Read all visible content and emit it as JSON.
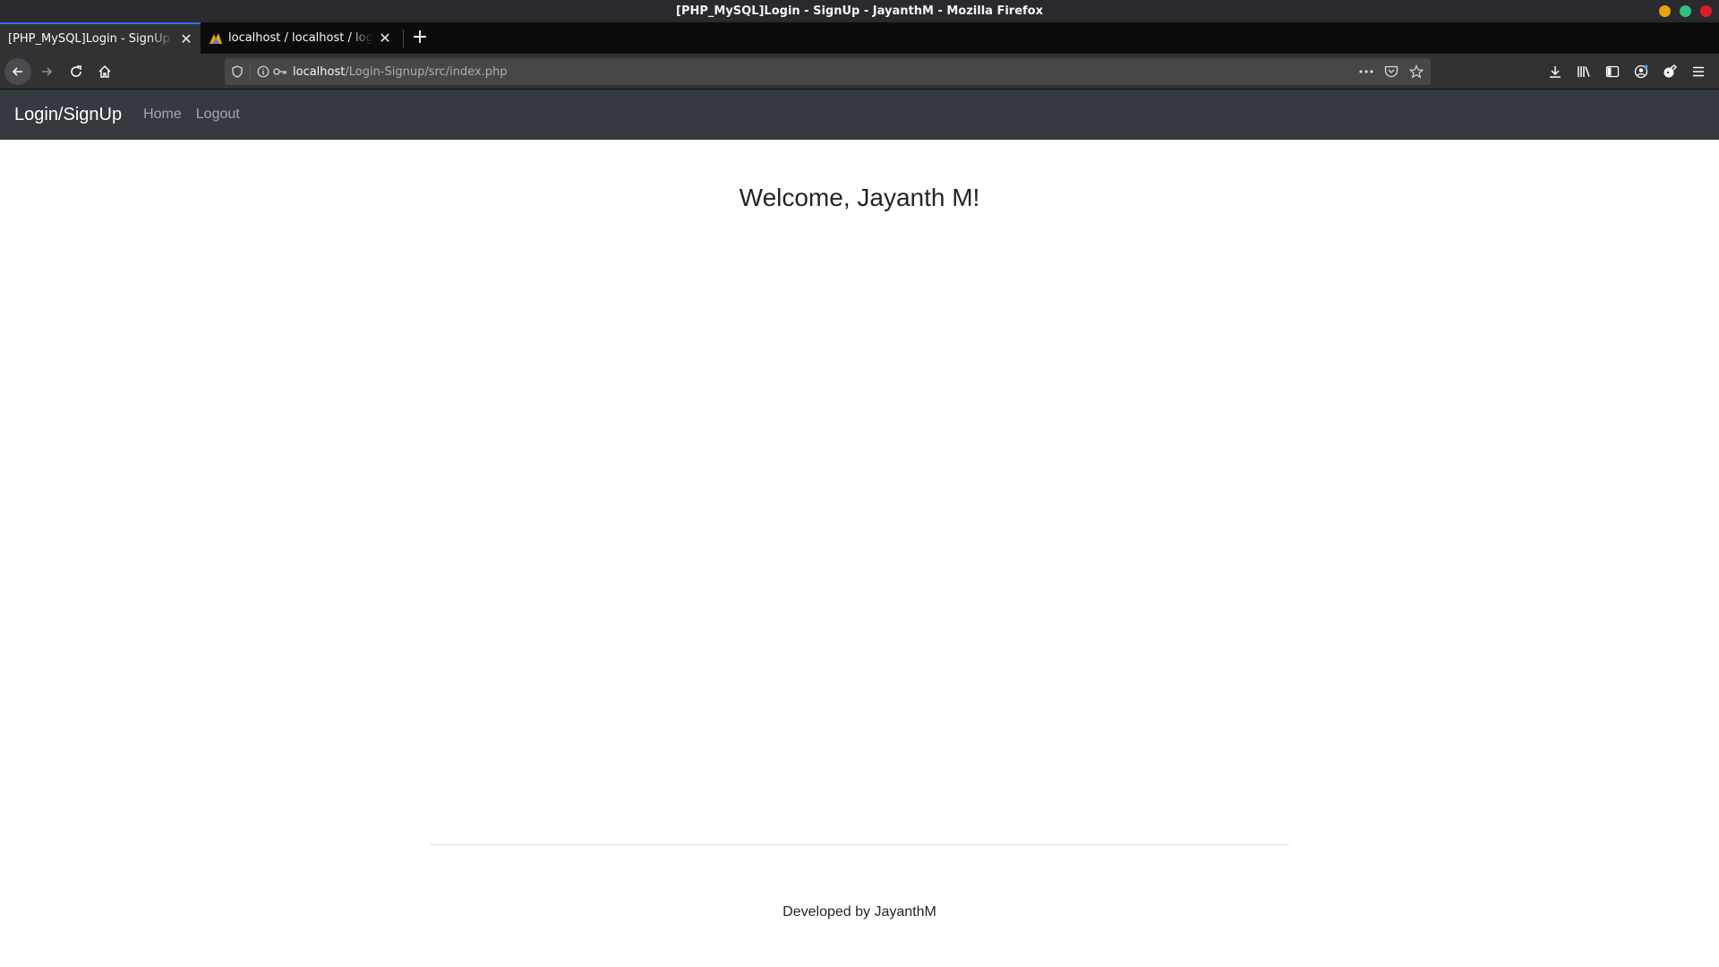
{
  "window": {
    "title": "[PHP_MySQL]Login - SignUp - JayanthM - Mozilla Firefox",
    "controls": {
      "minimize_color": "#e5a50a",
      "maximize_color": "#2ec27e",
      "close_color": "#e01b24"
    }
  },
  "tabs": [
    {
      "title": "[PHP_MySQL]Login - SignUp - J",
      "active": true
    },
    {
      "title": "localhost / localhost / login",
      "active": false,
      "favicon": "phpmyadmin-icon"
    }
  ],
  "toolbar": {
    "url_host": "localhost",
    "url_path": "/Login-Signup/src/index.php",
    "icons": [
      "back-icon",
      "forward-icon",
      "reload-icon",
      "home-icon",
      "shield-icon",
      "info-icon",
      "key-icon",
      "more-icon",
      "pocket-icon",
      "star-icon",
      "download-icon",
      "library-icon",
      "sidebar-icon",
      "account-icon",
      "extension-icon",
      "menu-icon"
    ]
  },
  "site": {
    "brand": "Login/SignUp",
    "nav": {
      "home": "Home",
      "logout": "Logout"
    },
    "welcome": "Welcome, Jayanth M!",
    "footer": "Developed by JayanthM",
    "navbar_color": "#343a40"
  }
}
